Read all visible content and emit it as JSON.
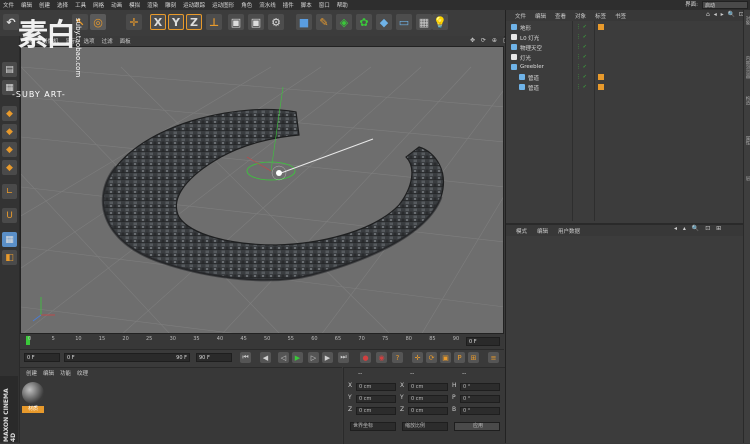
{
  "menubar": {
    "items": [
      "文件",
      "编辑",
      "创建",
      "选择",
      "工具",
      "网格",
      "动画",
      "模拟",
      "渲染",
      "雕刻",
      "运动跟踪",
      "运动图形",
      "角色",
      "流水线",
      "插件",
      "脚本",
      "窗口",
      "帮助"
    ],
    "layout_label": "界面:",
    "layout_value": "启动"
  },
  "viewport": {
    "menu": [
      "查看",
      "摄像机",
      "显示",
      "选项",
      "过滤",
      "面板"
    ],
    "icons": [
      "move-icon",
      "rotate-icon",
      "zoom-icon",
      "maximize-icon"
    ]
  },
  "watermark": {
    "logo_text": "素白",
    "line1": "-SUBY ART-",
    "line2": "suby.taobao.com"
  },
  "timeline": {
    "ticks": [
      "0",
      "5",
      "10",
      "15",
      "20",
      "25",
      "30",
      "35",
      "40",
      "45",
      "50",
      "55",
      "60",
      "65",
      "70",
      "75",
      "80",
      "85",
      "90"
    ],
    "current": "0 F"
  },
  "transport": {
    "start": "0 F",
    "min": "0 F",
    "max": "90 F",
    "end": "90 F"
  },
  "materials": {
    "menu": [
      "创建",
      "编辑",
      "功能",
      "纹理"
    ],
    "material_name": "材质"
  },
  "coords": {
    "header": [
      "--",
      "--",
      "--"
    ],
    "rows": [
      {
        "l1": "X",
        "v1": "0 cm",
        "l2": "X",
        "v2": "0 cm",
        "l3": "H",
        "v3": "0 °"
      },
      {
        "l1": "Y",
        "v1": "0 cm",
        "l2": "Y",
        "v2": "0 cm",
        "l3": "P",
        "v3": "0 °"
      },
      {
        "l1": "Z",
        "v1": "0 cm",
        "l2": "Z",
        "v2": "0 cm",
        "l3": "B",
        "v3": "0 °"
      }
    ],
    "mode1": "世界坐标",
    "mode2": "缩放比例",
    "apply": "应用"
  },
  "objects": {
    "menu": [
      "文件",
      "编辑",
      "查看",
      "对象",
      "标签",
      "书签"
    ],
    "items": [
      {
        "name": "地形",
        "indent": 0,
        "icon_color": "#6fb3e8"
      },
      {
        "name": "L0 灯光",
        "indent": 0,
        "icon_color": "#e8e8e8"
      },
      {
        "name": "物理天空",
        "indent": 0,
        "icon_color": "#6fb3e8"
      },
      {
        "name": "灯光",
        "indent": 0,
        "icon_color": "#e8e8e8"
      },
      {
        "name": "Greebler",
        "indent": 0,
        "icon_color": "#6fb3e8"
      },
      {
        "name": "管道",
        "indent": 1,
        "icon_color": "#6fb3e8"
      },
      {
        "name": "管道",
        "indent": 1,
        "icon_color": "#6fb3e8"
      }
    ]
  },
  "attributes": {
    "menu": [
      "模式",
      "编辑",
      "用户数据"
    ]
  },
  "right_edge": [
    "对象",
    "内容浏览器",
    "构造",
    "属性",
    "层"
  ],
  "colors": {
    "accent_orange": "#e89a2c",
    "selection_green": "#3ac83a",
    "axis_blue": "#4a7ed8"
  }
}
